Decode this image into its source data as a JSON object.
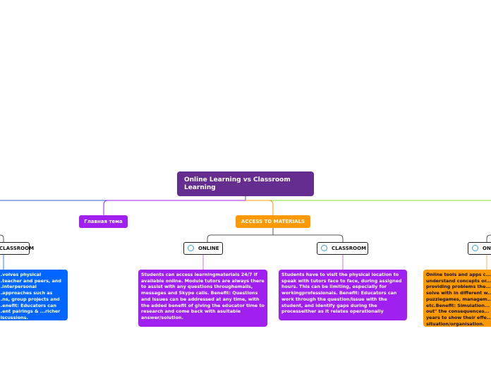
{
  "mindmap": {
    "root": {
      "label": "Online Learning vs Classroom Learning",
      "color": "#662d91"
    },
    "branches": [
      {
        "label": "Главная тема",
        "color": "#a020f0"
      },
      {
        "label": "ACCESS TO MATERIALS",
        "color": "#ff9900"
      }
    ],
    "subtopics": [
      {
        "label": "CLASSROOM",
        "icon": "circle-ring-icon"
      },
      {
        "label": "ONLINE",
        "icon": "circle-ring-icon"
      },
      {
        "label": "CLASSROOM",
        "icon": "circle-ring-icon"
      },
      {
        "label": "ONLINE",
        "icon": "circle-ring-icon"
      }
    ],
    "leaves": [
      {
        "text": "...volves physical ...teacher and peers, and ...interpersonal ...approaches such as ...ns, group projects and ...enefit: Educators can ...ent pairings & ...richer discussions.",
        "color": "#0066ff"
      },
      {
        "text": "Students can access learningmaterials 24/7 if available online. Module tutors are always there to assist with any questions throughemails, messages and Skype calls. Benefit: Questions and issues can be addressed at any time, with the added benefit of giving the educator time to research and come back with asuitable answer/solution.",
        "color": "#a020f0"
      },
      {
        "text": "Students have to visit the physical location to speak with tutors face to face, during assigned hours. This can be limiting, especially for workingprofessionals. Benefit: Educators can work through the question/issue with the student, and identify gaps during the processeither as it relates operationally",
        "color": "#a020f0"
      },
      {
        "text": "Online tools and apps c... understand concepts or... providing problems the... solve with in different w... puzzlegames, managem... etc.Benefit: Simulation... out\" the consequences... years to show their effe... situation/organisation.",
        "color": "#ff9900"
      }
    ]
  }
}
